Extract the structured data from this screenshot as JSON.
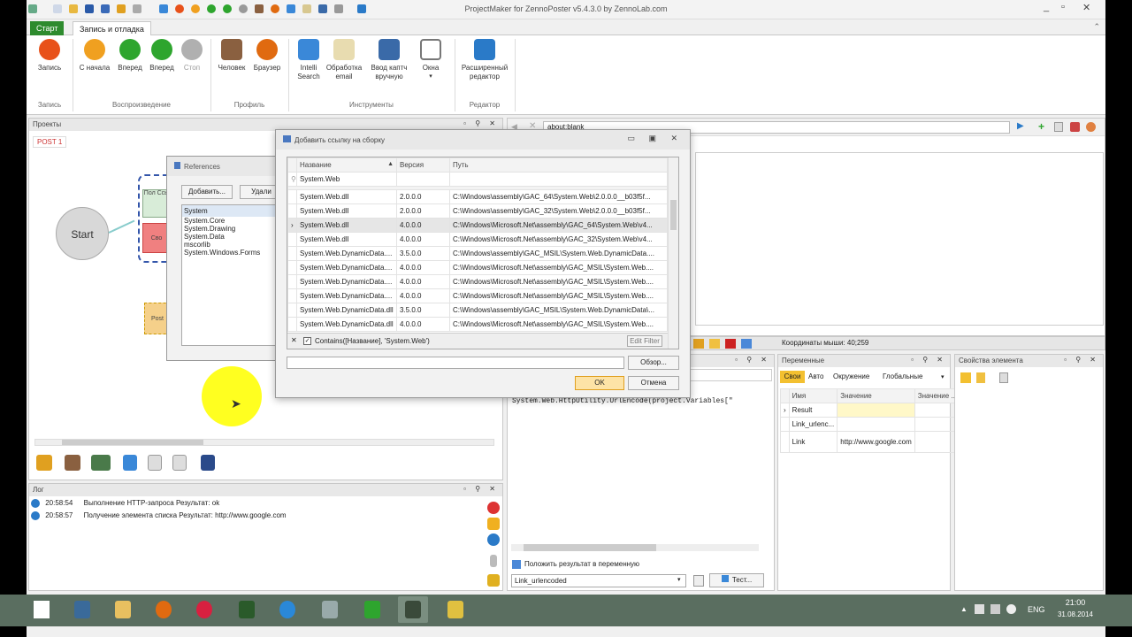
{
  "window": {
    "title": "ProjectMaker for ZennoPoster v5.4.3.0 by ZennoLab.com"
  },
  "ribbon": {
    "tabs": [
      "Старт",
      "Запись и отладка"
    ],
    "buttons": [
      {
        "label": "Запись",
        "icon": "record-icon",
        "color": "#e8511a"
      },
      {
        "label": "С начала",
        "icon": "restart-icon",
        "color": "#f0a020"
      },
      {
        "label": "Вперед",
        "icon": "play-icon",
        "color": "#2ea52e"
      },
      {
        "label": "Вперед",
        "icon": "step-forward-icon",
        "color": "#2ea52e"
      },
      {
        "label": "Стоп",
        "icon": "stop-icon",
        "color": "#b0b0b0"
      },
      {
        "label": "Человек",
        "icon": "person-icon",
        "color": "#8a6040"
      },
      {
        "label": "Браузер",
        "icon": "firefox-icon",
        "color": "#e06a10"
      },
      {
        "label": "Intelli Search",
        "icon": "intelli-search-icon",
        "color": "#3a88d8"
      },
      {
        "label": "Обработка email",
        "icon": "email-icon",
        "color": "#c8a850"
      },
      {
        "label": "Ввод каптч вручную",
        "icon": "captcha-icon",
        "color": "#3a6aa8"
      },
      {
        "label": "Окна",
        "icon": "windows-icon",
        "color": "#888888"
      },
      {
        "label": "Расширенный редактор",
        "icon": "advanced-editor-icon",
        "color": "#2a7ac8"
      }
    ],
    "groups": [
      "Запись",
      "Воспроизведение",
      "Профиль",
      "Инструменты",
      "Редактор"
    ]
  },
  "projects": {
    "title": "Проекты",
    "tab": "POST 1",
    "start": "Start",
    "node1": "Пол Ссы",
    "node2": "Сво",
    "node3": "Post"
  },
  "refs": {
    "title": "References",
    "add": "Добавить...",
    "remove": "Удали",
    "items": [
      "System",
      "System.Core",
      "System.Drawing",
      "System.Data",
      "mscorlib",
      "System.Windows.Forms"
    ]
  },
  "dialog": {
    "title": "Добавить ссылку на сборку",
    "columns": [
      "Название",
      "Версия",
      "Путь"
    ],
    "filter": "System.Web",
    "rows": [
      [
        "System.Web.dll",
        "2.0.0.0",
        "C:\\Windows\\assembly\\GAC_64\\System.Web\\2.0.0.0__b03f5f..."
      ],
      [
        "System.Web.dll",
        "2.0.0.0",
        "C:\\Windows\\assembly\\GAC_32\\System.Web\\2.0.0.0__b03f5f..."
      ],
      [
        "System.Web.dll",
        "4.0.0.0",
        "C:\\Windows\\Microsoft.Net\\assembly\\GAC_64\\System.Web\\v4..."
      ],
      [
        "System.Web.dll",
        "4.0.0.0",
        "C:\\Windows\\Microsoft.Net\\assembly\\GAC_32\\System.Web\\v4..."
      ],
      [
        "System.Web.DynamicData....",
        "3.5.0.0",
        "C:\\Windows\\assembly\\GAC_MSIL\\System.Web.DynamicData...."
      ],
      [
        "System.Web.DynamicData....",
        "4.0.0.0",
        "C:\\Windows\\Microsoft.Net\\assembly\\GAC_MSIL\\System.Web...."
      ],
      [
        "System.Web.DynamicData....",
        "4.0.0.0",
        "C:\\Windows\\Microsoft.Net\\assembly\\GAC_MSIL\\System.Web...."
      ],
      [
        "System.Web.DynamicData....",
        "4.0.0.0",
        "C:\\Windows\\Microsoft.Net\\assembly\\GAC_MSIL\\System.Web...."
      ],
      [
        "System.Web.DynamicData.dll",
        "3.5.0.0",
        "C:\\Windows\\assembly\\GAC_MSIL\\System.Web.DynamicData\\..."
      ],
      [
        "System.Web.DynamicData.dll",
        "4.0.0.0",
        "C:\\Windows\\Microsoft.Net\\assembly\\GAC_MSIL\\System.Web...."
      ]
    ],
    "filter_expr": "Contains([Название], 'System.Web')",
    "edit_filter": "Edit Filter",
    "browse": "Обзор...",
    "ok": "OK",
    "cancel": "Отмена"
  },
  "browser": {
    "url": "about:blank",
    "coords": "Координаты мыши: 40;259"
  },
  "code": {
    "text": "System.Web.HttpUtility.UrlEncode(project.Variables[\"",
    "put_result": "Положить результат в переменную",
    "var": "Link_urlencoded",
    "test": "Тест..."
  },
  "vars": {
    "title": "Переменные",
    "tabs": [
      "Свои",
      "Авто",
      "Окружение",
      "Глобальные"
    ],
    "columns": [
      "Имя",
      "Значение",
      "Значение ..."
    ],
    "rows": [
      [
        "Result",
        ""
      ],
      [
        "Link_urlenc...",
        ""
      ],
      [
        "Link",
        "http://www.google.com"
      ]
    ]
  },
  "props": {
    "title": "Свойства элемента"
  },
  "log": {
    "title": "Лог",
    "entries": [
      {
        "time": "20:58:54",
        "text": "Выполнение HTTP-запроса  Результат: ok"
      },
      {
        "time": "20:58:57",
        "text": "Получение элемента списка  Результат: http://www.google.com"
      }
    ]
  },
  "taskbar": {
    "lang": "ENG",
    "time": "21:00",
    "date": "31.08.2014"
  }
}
